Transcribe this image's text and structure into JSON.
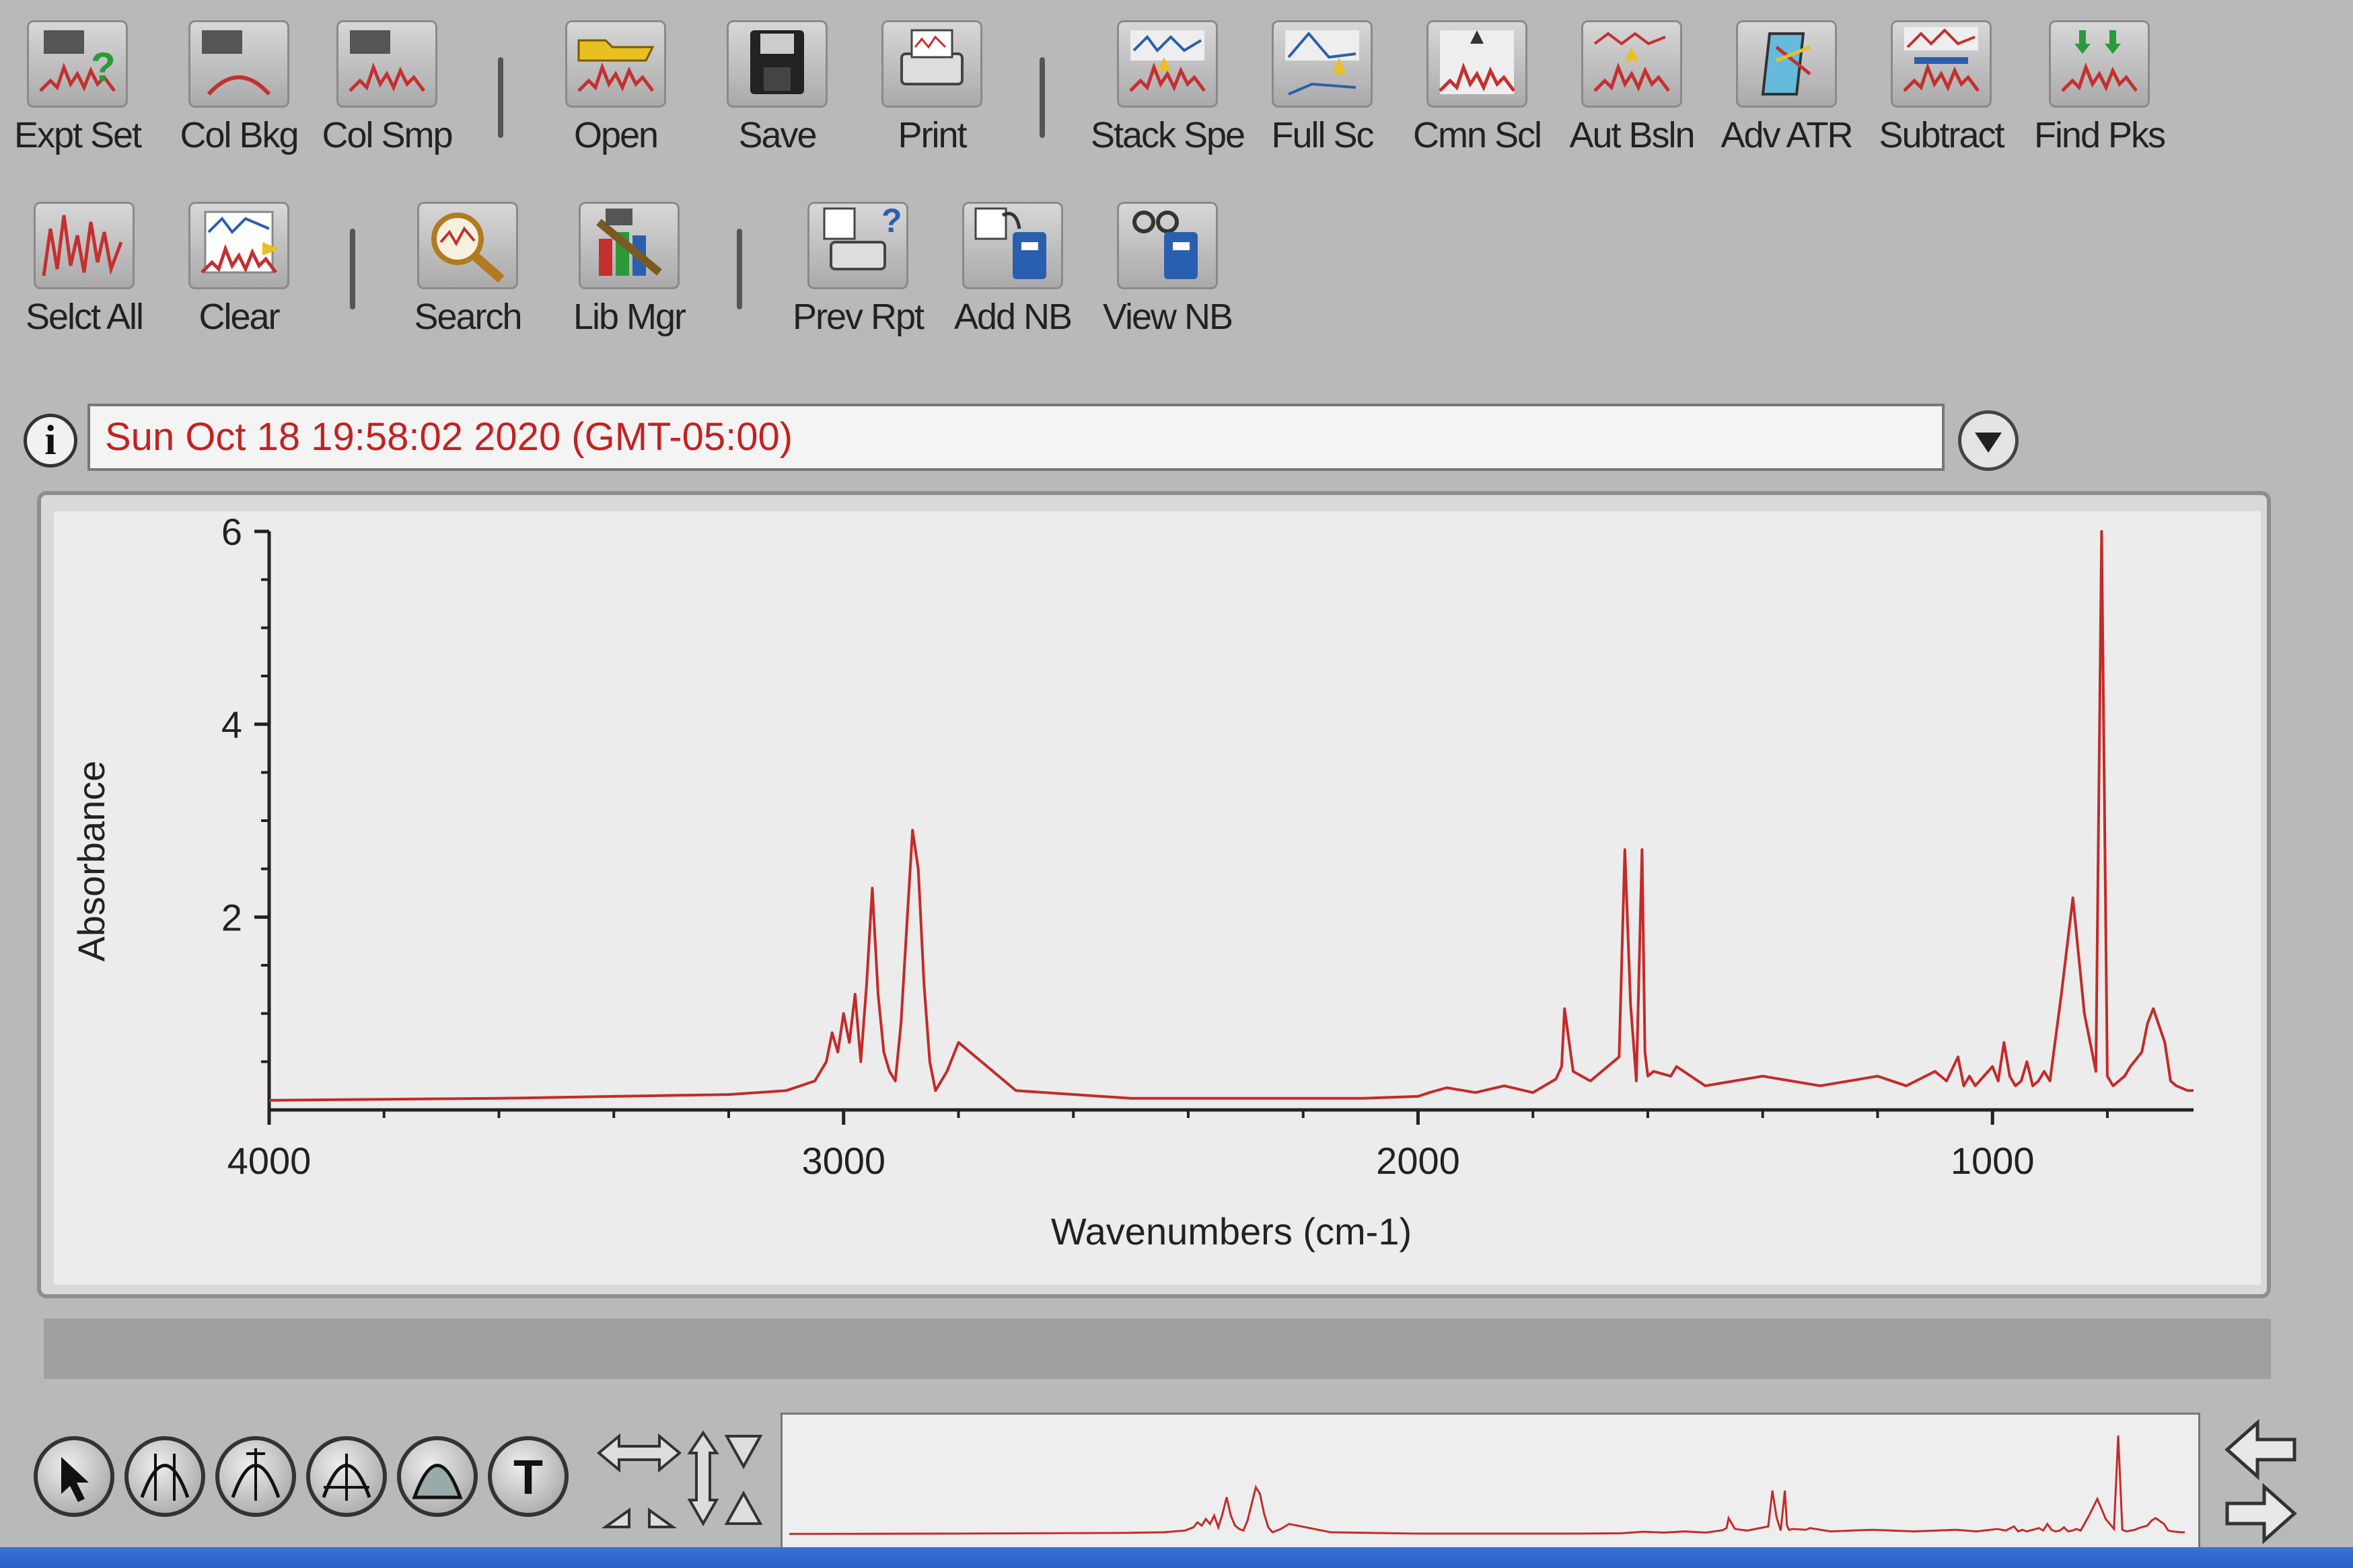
{
  "toolbar_row1": [
    {
      "id": "expt-set",
      "label": "Expt Set",
      "icon": "experiment-setup-icon"
    },
    {
      "id": "col-bkg",
      "label": "Col Bkg",
      "icon": "collect-background-icon"
    },
    {
      "id": "col-smp",
      "label": "Col Smp",
      "icon": "collect-sample-icon"
    },
    {
      "id": "open",
      "label": "Open",
      "icon": "open-folder-icon"
    },
    {
      "id": "save",
      "label": "Save",
      "icon": "floppy-disk-icon"
    },
    {
      "id": "print",
      "label": "Print",
      "icon": "printer-icon"
    },
    {
      "id": "stack-spe",
      "label": "Stack Spe",
      "icon": "stack-spectra-icon"
    },
    {
      "id": "full-sc",
      "label": "Full Sc",
      "icon": "full-scale-icon"
    },
    {
      "id": "cmn-scl",
      "label": "Cmn Scl",
      "icon": "common-scale-icon"
    },
    {
      "id": "aut-bsln",
      "label": "Aut Bsln",
      "icon": "auto-baseline-icon"
    },
    {
      "id": "adv-atr",
      "label": "Adv ATR",
      "icon": "advanced-atr-icon"
    },
    {
      "id": "subtract",
      "label": "Subtract",
      "icon": "subtract-icon"
    },
    {
      "id": "find-pks",
      "label": "Find Pks",
      "icon": "find-peaks-icon"
    }
  ],
  "toolbar_row2": [
    {
      "id": "select-all",
      "label": "Selct All",
      "icon": "select-all-icon"
    },
    {
      "id": "clear",
      "label": "Clear",
      "icon": "clear-icon"
    },
    {
      "id": "search",
      "label": "Search",
      "icon": "search-icon"
    },
    {
      "id": "lib-mgr",
      "label": "Lib Mgr",
      "icon": "library-manager-icon"
    },
    {
      "id": "prev-rpt",
      "label": "Prev Rpt",
      "icon": "preview-report-icon"
    },
    {
      "id": "add-nb",
      "label": "Add NB",
      "icon": "add-notebook-icon"
    },
    {
      "id": "view-nb",
      "label": "View NB",
      "icon": "view-notebook-icon"
    }
  ],
  "info": {
    "text": "Sun Oct 18 19:58:02 2020 (GMT-05:00)"
  },
  "colors": {
    "spectrum": "#c42a2a",
    "info_text": "#c32222",
    "axis": "#222222"
  },
  "chart_data": {
    "type": "line",
    "xlabel": "Wavenumbers (cm-1)",
    "ylabel": "Absorbance",
    "xlim": [
      4000,
      650
    ],
    "ylim": [
      0,
      6
    ],
    "x_ticks": [
      "4000",
      "3000",
      "2000",
      "1000"
    ],
    "y_ticks": [
      "6",
      "4",
      "2"
    ],
    "grid": false,
    "series": [
      {
        "x": [
          4000,
          3800,
          3600,
          3400,
          3200,
          3100,
          3050,
          3030,
          3020,
          3010,
          3000,
          2990,
          2980,
          2970,
          2960,
          2950,
          2940,
          2930,
          2920,
          2910,
          2900,
          2890,
          2880,
          2870,
          2860,
          2850,
          2840,
          2820,
          2800,
          2700,
          2500,
          2300,
          2100,
          2050,
          2000,
          1980,
          1950,
          1900,
          1850,
          1800,
          1760,
          1750,
          1745,
          1730,
          1700,
          1650,
          1640,
          1630,
          1620,
          1610,
          1605,
          1600,
          1590,
          1560,
          1550,
          1500,
          1450,
          1400,
          1300,
          1200,
          1150,
          1100,
          1080,
          1060,
          1050,
          1040,
          1030,
          1000,
          990,
          980,
          970,
          960,
          950,
          940,
          930,
          920,
          910,
          900,
          880,
          860,
          840,
          820,
          810,
          800,
          790,
          780,
          770,
          760,
          740,
          730,
          720,
          700,
          690,
          680,
          660,
          650
        ],
        "y": [
          0.1,
          0.11,
          0.12,
          0.14,
          0.16,
          0.2,
          0.3,
          0.5,
          0.8,
          0.6,
          1.0,
          0.7,
          1.2,
          0.5,
          1.3,
          2.3,
          1.2,
          0.6,
          0.4,
          0.3,
          0.9,
          1.9,
          2.9,
          2.5,
          1.3,
          0.5,
          0.2,
          0.4,
          0.7,
          0.2,
          0.12,
          0.12,
          0.12,
          0.13,
          0.14,
          0.18,
          0.23,
          0.18,
          0.25,
          0.18,
          0.32,
          0.45,
          1.05,
          0.4,
          0.3,
          0.55,
          2.7,
          1.1,
          0.3,
          2.7,
          0.6,
          0.35,
          0.4,
          0.35,
          0.45,
          0.25,
          0.3,
          0.35,
          0.25,
          0.35,
          0.25,
          0.4,
          0.3,
          0.55,
          0.25,
          0.35,
          0.25,
          0.45,
          0.3,
          0.7,
          0.35,
          0.25,
          0.3,
          0.5,
          0.25,
          0.3,
          0.4,
          0.3,
          1.2,
          2.2,
          1.0,
          0.4,
          6.0,
          0.35,
          0.25,
          0.3,
          0.35,
          0.45,
          0.6,
          0.9,
          1.05,
          0.7,
          0.3,
          0.25,
          0.2,
          0.2
        ]
      }
    ]
  }
}
